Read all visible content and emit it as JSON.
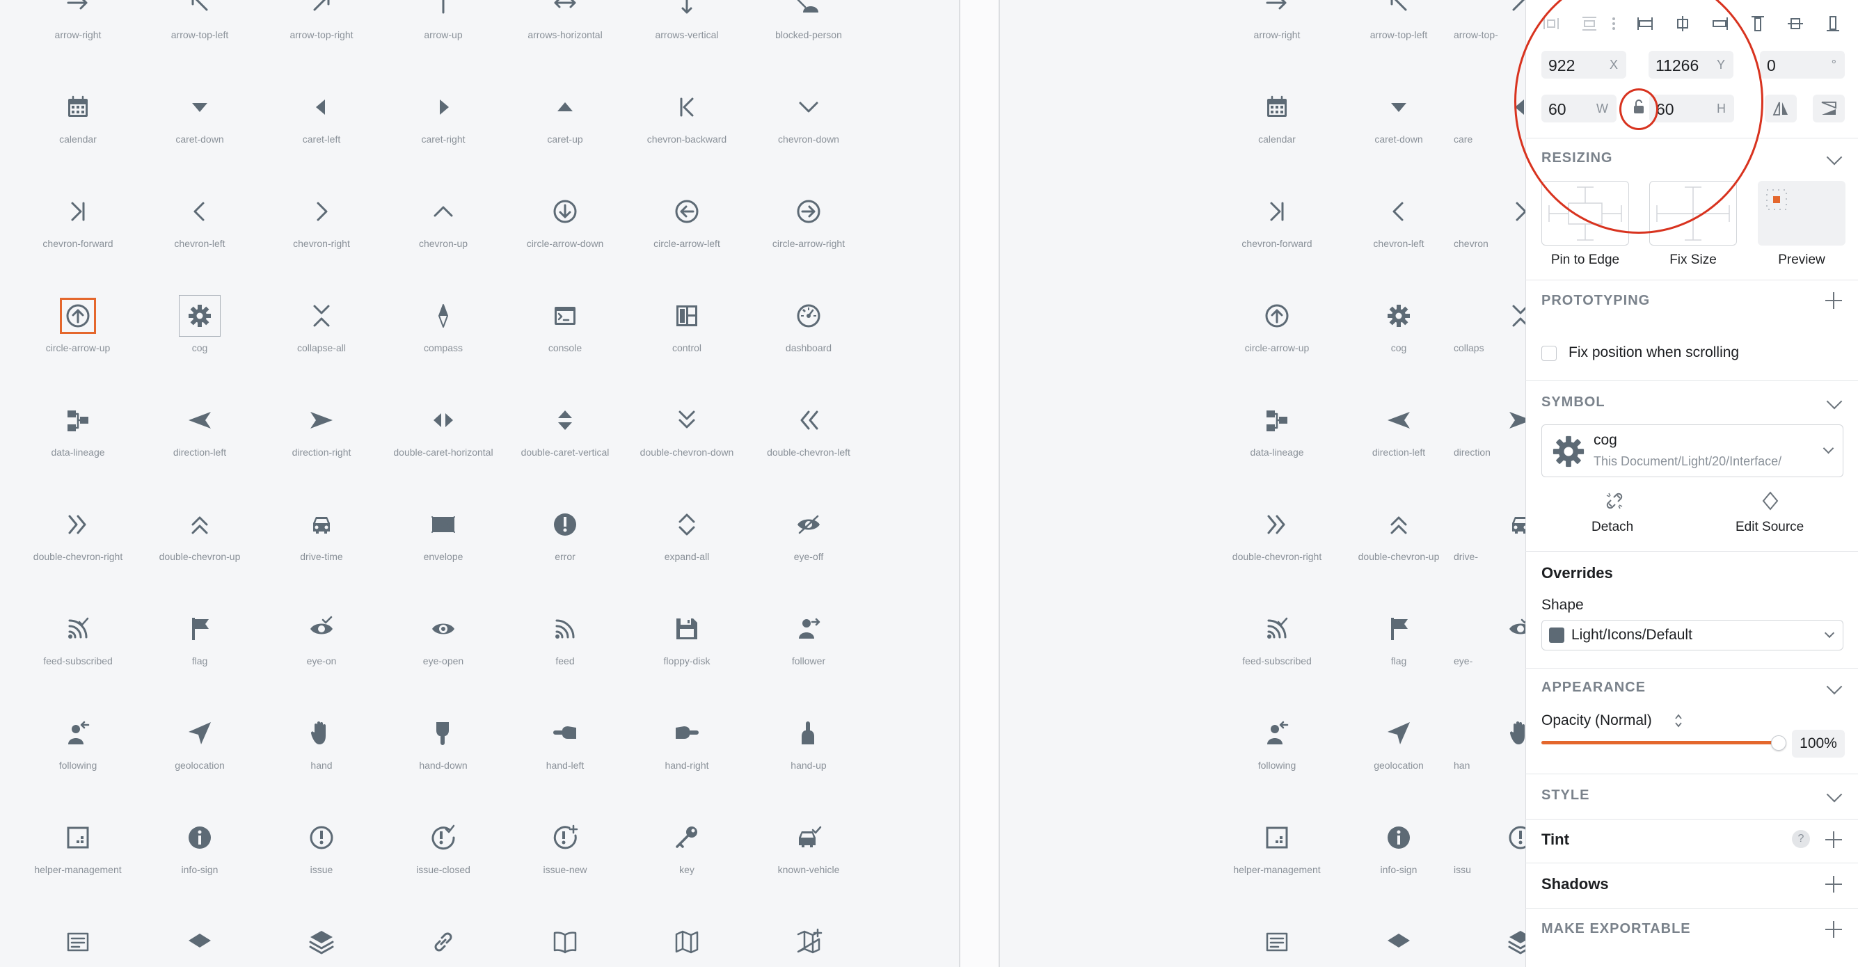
{
  "icon_rows": [
    [
      [
        "arrow-right",
        "arrow-right"
      ],
      [
        "arrow-top-left",
        "arrow-top-left"
      ],
      [
        "arrow-top-right",
        "arrow-top-right"
      ],
      [
        "arrow-up",
        "arrow-up"
      ],
      [
        "arrows-horizontal",
        "arrows-horizontal"
      ],
      [
        "arrows-vertical",
        "arrows-vertical"
      ],
      [
        "blocked-person",
        "blocked-person"
      ]
    ],
    [
      [
        "calendar",
        "calendar"
      ],
      [
        "caret-down",
        "caret-down"
      ],
      [
        "caret-left",
        "caret-left"
      ],
      [
        "caret-right",
        "caret-right"
      ],
      [
        "caret-up",
        "caret-up"
      ],
      [
        "chevron-backward",
        "chevron-backward"
      ],
      [
        "chevron-down",
        "chevron-down"
      ]
    ],
    [
      [
        "chevron-forward",
        "chevron-forward"
      ],
      [
        "chevron-left",
        "chevron-left"
      ],
      [
        "chevron-right",
        "chevron-right"
      ],
      [
        "chevron-up",
        "chevron-up"
      ],
      [
        "circle-arrow-down",
        "circle-arrow-down"
      ],
      [
        "circle-arrow-left",
        "circle-arrow-left"
      ],
      [
        "circle-arrow-right",
        "circle-arrow-right"
      ]
    ],
    [
      [
        "circle-arrow-up",
        "circle-arrow-up"
      ],
      [
        "cog",
        "cog"
      ],
      [
        "collapse-all",
        "collapse-all"
      ],
      [
        "compass",
        "compass"
      ],
      [
        "console",
        "console"
      ],
      [
        "control",
        "control"
      ],
      [
        "dashboard",
        "dashboard"
      ]
    ],
    [
      [
        "data-lineage",
        "data-lineage"
      ],
      [
        "direction-left",
        "direction-left"
      ],
      [
        "direction-right",
        "direction-right"
      ],
      [
        "double-caret-horizontal",
        "double-caret-horizontal"
      ],
      [
        "double-caret-vertical",
        "double-caret-vertical"
      ],
      [
        "double-chevron-down",
        "double-chevron-down"
      ],
      [
        "double-chevron-left",
        "double-chevron-left"
      ]
    ],
    [
      [
        "double-chevron-right",
        "double-chevron-right"
      ],
      [
        "double-chevron-up",
        "double-chevron-up"
      ],
      [
        "drive-time",
        "drive-time"
      ],
      [
        "envelope",
        "envelope"
      ],
      [
        "error",
        "error"
      ],
      [
        "expand-all",
        "expand-all"
      ],
      [
        "eye-off",
        "eye-off"
      ]
    ],
    [
      [
        "feed-subscribed",
        "feed-subscribed"
      ],
      [
        "flag",
        "flag"
      ],
      [
        "eye-on",
        "eye-on"
      ],
      [
        "eye-open",
        "eye-open"
      ],
      [
        "feed",
        "feed"
      ],
      [
        "floppy-disk",
        "floppy-disk"
      ],
      [
        "follower",
        "follower"
      ]
    ],
    [
      [
        "following",
        "following"
      ],
      [
        "geolocation",
        "geolocation"
      ],
      [
        "hand",
        "hand"
      ],
      [
        "hand-down",
        "hand-down"
      ],
      [
        "hand-left",
        "hand-left"
      ],
      [
        "hand-right",
        "hand-right"
      ],
      [
        "hand-up",
        "hand-up"
      ]
    ],
    [
      [
        "helper-management",
        "helper-management"
      ],
      [
        "info-sign",
        "info-sign"
      ],
      [
        "issue",
        "issue"
      ],
      [
        "issue-closed",
        "issue-closed"
      ],
      [
        "issue-new",
        "issue-new"
      ],
      [
        "key",
        "key"
      ],
      [
        "known-vehicle",
        "known-vehicle"
      ]
    ],
    [
      [
        "label",
        "label"
      ],
      [
        "layer",
        "layer"
      ],
      [
        "layers",
        "layers"
      ],
      [
        "link",
        "link"
      ],
      [
        "manual",
        "manual"
      ],
      [
        "map",
        "map"
      ],
      [
        "map-create",
        "map-create"
      ]
    ]
  ],
  "right_pane_labels": [
    [
      "arrow-right",
      "arrow-top-left",
      "arrow-top-"
    ],
    [
      "calendar",
      "caret-down",
      "care"
    ],
    [
      "chevron-forward",
      "chevron-left",
      "chevron"
    ],
    [
      "circle-arrow-up",
      "cog",
      "collaps"
    ],
    [
      "data-lineage",
      "direction-left",
      "direction"
    ],
    [
      "double-chevron-right",
      "double-chevron-up",
      "drive-"
    ],
    [
      "feed-subscribed",
      "flag",
      "eye-"
    ],
    [
      "following",
      "geolocation",
      "han"
    ],
    [
      "helper-management",
      "info-sign",
      "issu"
    ],
    [
      "",
      "",
      ""
    ]
  ],
  "inspector": {
    "position": {
      "x": "922",
      "x_label": "X",
      "y": "11266",
      "y_label": "Y",
      "rotation": "0",
      "rotation_label": "°"
    },
    "size": {
      "w": "60",
      "w_label": "W",
      "h": "60",
      "h_label": "H"
    },
    "resizing": {
      "title": "RESIZING",
      "options": [
        "Pin to Edge",
        "Fix Size",
        "Preview"
      ]
    },
    "prototyping": {
      "title": "PROTOTYPING",
      "fix_position": "Fix position when scrolling"
    },
    "symbol": {
      "title": "SYMBOL",
      "name": "cog",
      "path": "This Document/Light/20/Interface/",
      "detach": "Detach",
      "edit_source": "Edit Source"
    },
    "overrides": {
      "title": "Overrides",
      "shape_label": "Shape",
      "shape_value": "Light/Icons/Default"
    },
    "appearance": {
      "title": "APPEARANCE",
      "opacity_label": "Opacity (Normal)",
      "opacity_value": "100%",
      "opacity": 1.0
    },
    "style": {
      "title": "STYLE"
    },
    "tint": {
      "title": "Tint",
      "help": "?"
    },
    "shadows": {
      "title": "Shadows"
    },
    "exportable": {
      "title": "MAKE EXPORTABLE"
    }
  },
  "colors": {
    "icon": "#5d6a75",
    "accent": "#e4672d",
    "annotation": "#d8331f"
  }
}
